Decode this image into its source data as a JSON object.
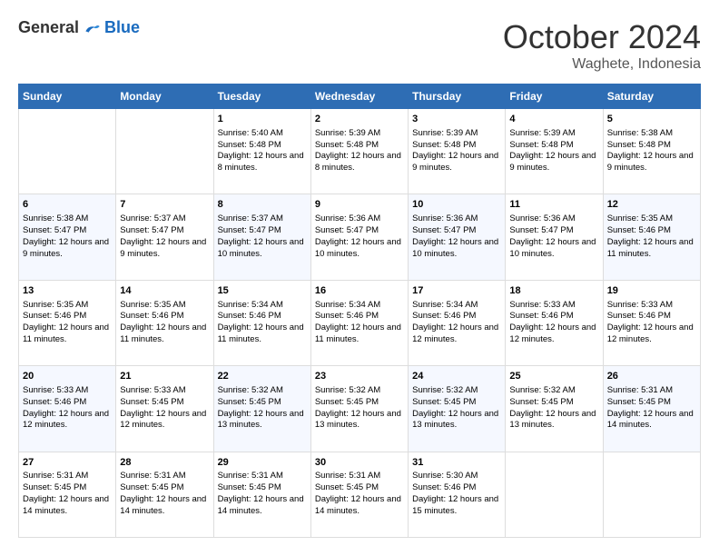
{
  "logo": {
    "general": "General",
    "blue": "Blue"
  },
  "header": {
    "month": "October 2024",
    "location": "Waghete, Indonesia"
  },
  "weekdays": [
    "Sunday",
    "Monday",
    "Tuesday",
    "Wednesday",
    "Thursday",
    "Friday",
    "Saturday"
  ],
  "weeks": [
    [
      {
        "day": "",
        "sunrise": "",
        "sunset": "",
        "daylight": ""
      },
      {
        "day": "",
        "sunrise": "",
        "sunset": "",
        "daylight": ""
      },
      {
        "day": "1",
        "sunrise": "Sunrise: 5:40 AM",
        "sunset": "Sunset: 5:48 PM",
        "daylight": "Daylight: 12 hours and 8 minutes."
      },
      {
        "day": "2",
        "sunrise": "Sunrise: 5:39 AM",
        "sunset": "Sunset: 5:48 PM",
        "daylight": "Daylight: 12 hours and 8 minutes."
      },
      {
        "day": "3",
        "sunrise": "Sunrise: 5:39 AM",
        "sunset": "Sunset: 5:48 PM",
        "daylight": "Daylight: 12 hours and 9 minutes."
      },
      {
        "day": "4",
        "sunrise": "Sunrise: 5:39 AM",
        "sunset": "Sunset: 5:48 PM",
        "daylight": "Daylight: 12 hours and 9 minutes."
      },
      {
        "day": "5",
        "sunrise": "Sunrise: 5:38 AM",
        "sunset": "Sunset: 5:48 PM",
        "daylight": "Daylight: 12 hours and 9 minutes."
      }
    ],
    [
      {
        "day": "6",
        "sunrise": "Sunrise: 5:38 AM",
        "sunset": "Sunset: 5:47 PM",
        "daylight": "Daylight: 12 hours and 9 minutes."
      },
      {
        "day": "7",
        "sunrise": "Sunrise: 5:37 AM",
        "sunset": "Sunset: 5:47 PM",
        "daylight": "Daylight: 12 hours and 9 minutes."
      },
      {
        "day": "8",
        "sunrise": "Sunrise: 5:37 AM",
        "sunset": "Sunset: 5:47 PM",
        "daylight": "Daylight: 12 hours and 10 minutes."
      },
      {
        "day": "9",
        "sunrise": "Sunrise: 5:36 AM",
        "sunset": "Sunset: 5:47 PM",
        "daylight": "Daylight: 12 hours and 10 minutes."
      },
      {
        "day": "10",
        "sunrise": "Sunrise: 5:36 AM",
        "sunset": "Sunset: 5:47 PM",
        "daylight": "Daylight: 12 hours and 10 minutes."
      },
      {
        "day": "11",
        "sunrise": "Sunrise: 5:36 AM",
        "sunset": "Sunset: 5:47 PM",
        "daylight": "Daylight: 12 hours and 10 minutes."
      },
      {
        "day": "12",
        "sunrise": "Sunrise: 5:35 AM",
        "sunset": "Sunset: 5:46 PM",
        "daylight": "Daylight: 12 hours and 11 minutes."
      }
    ],
    [
      {
        "day": "13",
        "sunrise": "Sunrise: 5:35 AM",
        "sunset": "Sunset: 5:46 PM",
        "daylight": "Daylight: 12 hours and 11 minutes."
      },
      {
        "day": "14",
        "sunrise": "Sunrise: 5:35 AM",
        "sunset": "Sunset: 5:46 PM",
        "daylight": "Daylight: 12 hours and 11 minutes."
      },
      {
        "day": "15",
        "sunrise": "Sunrise: 5:34 AM",
        "sunset": "Sunset: 5:46 PM",
        "daylight": "Daylight: 12 hours and 11 minutes."
      },
      {
        "day": "16",
        "sunrise": "Sunrise: 5:34 AM",
        "sunset": "Sunset: 5:46 PM",
        "daylight": "Daylight: 12 hours and 11 minutes."
      },
      {
        "day": "17",
        "sunrise": "Sunrise: 5:34 AM",
        "sunset": "Sunset: 5:46 PM",
        "daylight": "Daylight: 12 hours and 12 minutes."
      },
      {
        "day": "18",
        "sunrise": "Sunrise: 5:33 AM",
        "sunset": "Sunset: 5:46 PM",
        "daylight": "Daylight: 12 hours and 12 minutes."
      },
      {
        "day": "19",
        "sunrise": "Sunrise: 5:33 AM",
        "sunset": "Sunset: 5:46 PM",
        "daylight": "Daylight: 12 hours and 12 minutes."
      }
    ],
    [
      {
        "day": "20",
        "sunrise": "Sunrise: 5:33 AM",
        "sunset": "Sunset: 5:46 PM",
        "daylight": "Daylight: 12 hours and 12 minutes."
      },
      {
        "day": "21",
        "sunrise": "Sunrise: 5:33 AM",
        "sunset": "Sunset: 5:45 PM",
        "daylight": "Daylight: 12 hours and 12 minutes."
      },
      {
        "day": "22",
        "sunrise": "Sunrise: 5:32 AM",
        "sunset": "Sunset: 5:45 PM",
        "daylight": "Daylight: 12 hours and 13 minutes."
      },
      {
        "day": "23",
        "sunrise": "Sunrise: 5:32 AM",
        "sunset": "Sunset: 5:45 PM",
        "daylight": "Daylight: 12 hours and 13 minutes."
      },
      {
        "day": "24",
        "sunrise": "Sunrise: 5:32 AM",
        "sunset": "Sunset: 5:45 PM",
        "daylight": "Daylight: 12 hours and 13 minutes."
      },
      {
        "day": "25",
        "sunrise": "Sunrise: 5:32 AM",
        "sunset": "Sunset: 5:45 PM",
        "daylight": "Daylight: 12 hours and 13 minutes."
      },
      {
        "day": "26",
        "sunrise": "Sunrise: 5:31 AM",
        "sunset": "Sunset: 5:45 PM",
        "daylight": "Daylight: 12 hours and 14 minutes."
      }
    ],
    [
      {
        "day": "27",
        "sunrise": "Sunrise: 5:31 AM",
        "sunset": "Sunset: 5:45 PM",
        "daylight": "Daylight: 12 hours and 14 minutes."
      },
      {
        "day": "28",
        "sunrise": "Sunrise: 5:31 AM",
        "sunset": "Sunset: 5:45 PM",
        "daylight": "Daylight: 12 hours and 14 minutes."
      },
      {
        "day": "29",
        "sunrise": "Sunrise: 5:31 AM",
        "sunset": "Sunset: 5:45 PM",
        "daylight": "Daylight: 12 hours and 14 minutes."
      },
      {
        "day": "30",
        "sunrise": "Sunrise: 5:31 AM",
        "sunset": "Sunset: 5:45 PM",
        "daylight": "Daylight: 12 hours and 14 minutes."
      },
      {
        "day": "31",
        "sunrise": "Sunrise: 5:30 AM",
        "sunset": "Sunset: 5:46 PM",
        "daylight": "Daylight: 12 hours and 15 minutes."
      },
      {
        "day": "",
        "sunrise": "",
        "sunset": "",
        "daylight": ""
      },
      {
        "day": "",
        "sunrise": "",
        "sunset": "",
        "daylight": ""
      }
    ]
  ]
}
